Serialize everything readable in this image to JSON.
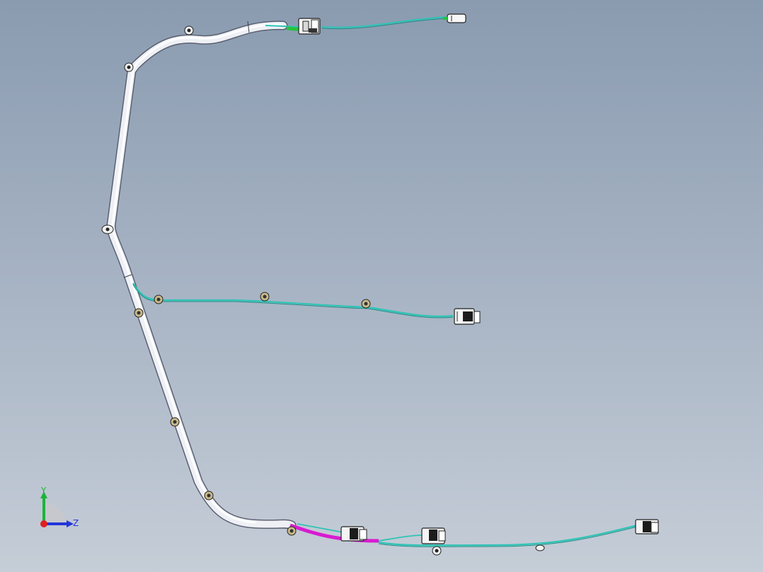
{
  "viewport": {
    "background_top": "#8a9bb0",
    "background_bottom": "#c5cdd7"
  },
  "colors": {
    "harness_tube": "#e8ebf2",
    "harness_outline": "#5a6070",
    "wire_teal": "#2ec4b6",
    "wire_magenta": "#d81bd0",
    "wire_green": "#27c23a",
    "clip_tan": "#c9b98a"
  },
  "branches": [
    {
      "name": "top-branch",
      "connector": "top-connector"
    },
    {
      "name": "middle-branch",
      "connector": "middle-connector"
    },
    {
      "name": "bottom-branch",
      "connectors": [
        "bottom-connector-1",
        "bottom-connector-2",
        "bottom-connector-3"
      ]
    }
  ],
  "triad": {
    "y_label": "Y",
    "z_label": "Z",
    "y_color": "#1db33a",
    "z_color": "#2336d8",
    "x_color": "#e02020"
  }
}
